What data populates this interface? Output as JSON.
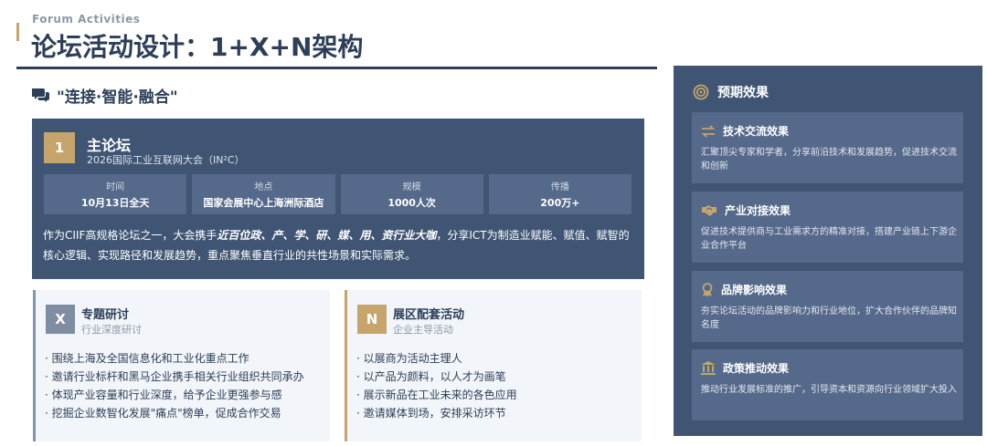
{
  "header": {
    "eyebrow": "Forum Activities",
    "title": "论坛活动设计：1+X+N架构"
  },
  "section": {
    "icon": "comments-icon",
    "title": "\"连接·智能·融合\""
  },
  "main_forum": {
    "badge": "1",
    "title": "主论坛",
    "subtitle": "2026国际工业互联网大会（IN²C）",
    "stats": [
      {
        "label": "时间",
        "value": "10月13日全天"
      },
      {
        "label": "地点",
        "value": "国家会展中心上海洲际酒店"
      },
      {
        "label": "规模",
        "value": "1000人次"
      },
      {
        "label": "传播",
        "value": "200万+"
      }
    ],
    "desc_before": "作为CIIF高规格论坛之一，大会携手",
    "desc_emphasis": "近百位政、产、学、研、媒、用、资行业大咖",
    "desc_after": "，分享ICT为制造业赋能、赋值、赋智的核心逻辑、实现路径和发展趋势，重点聚焦垂直行业的共性场景和实际需求。"
  },
  "topic_seminar": {
    "badge": "X",
    "title": "专题研讨",
    "subtitle": "行业深度研讨",
    "items": [
      "· 围绕上海及全国信息化和工业化重点工作",
      "· 邀请行业标杆和黑马企业携手相关行业组织共同承办",
      "· 体现产业容量和行业深度，给予企业更强参与感",
      "· 挖掘企业数智化发展\"痛点\"榜单，促成合作交易"
    ]
  },
  "exhibit_activities": {
    "badge": "N",
    "title": "展区配套活动",
    "subtitle": "企业主导活动",
    "items": [
      "· 以展商为活动主理人",
      "· 以产品为颜料，以人才为画笔",
      "· 展示新品在工业未来的各色应用",
      "· 邀请媒体到场，安排采访环节"
    ]
  },
  "expected": {
    "icon": "target-icon",
    "title": "预期效果",
    "effects": [
      {
        "icon": "exchange-icon",
        "title": "技术交流效果",
        "desc": "汇聚顶尖专家和学者，分享前沿技术和发展趋势，促进技术交流和创新"
      },
      {
        "icon": "handshake-icon",
        "title": "产业对接效果",
        "desc": "促进技术提供商与工业需求方的精准对接，搭建产业链上下游企业合作平台"
      },
      {
        "icon": "award-icon",
        "title": "品牌影响效果",
        "desc": "夯实论坛活动的品牌影响力和行业地位，扩大合作伙伴的品牌知名度"
      },
      {
        "icon": "landmark-icon",
        "title": "政策推动效果",
        "desc": "推动行业发展标准的推广，引导资本和资源向行业领域扩大投入"
      }
    ]
  },
  "colors": {
    "navy": "#3f5573",
    "gold": "#c5a56c",
    "slate": "#7f8da3"
  }
}
